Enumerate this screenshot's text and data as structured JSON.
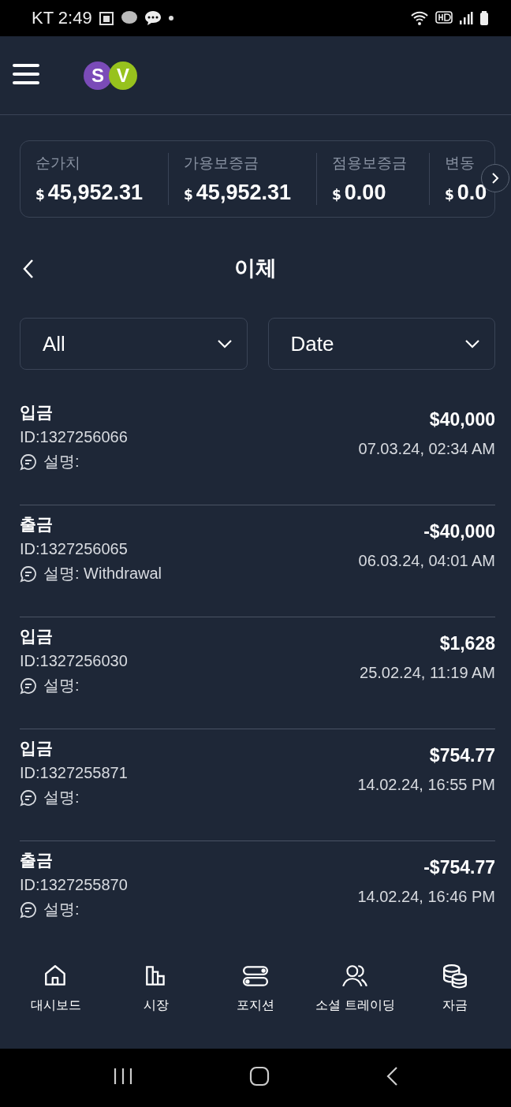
{
  "status_bar": {
    "carrier_time": "KT 2:49"
  },
  "header": {
    "logo_letters": [
      "S",
      "V"
    ]
  },
  "summary": [
    {
      "label": "순가치",
      "currency": "$",
      "value": "45,952.31"
    },
    {
      "label": "가용보증금",
      "currency": "$",
      "value": "45,952.31"
    },
    {
      "label": "점용보증금",
      "currency": "$",
      "value": "0.00"
    },
    {
      "label": "변동",
      "currency": "$",
      "value": "0.0"
    }
  ],
  "page_title": "이체",
  "filters": [
    {
      "value": "All"
    },
    {
      "value": "Date"
    }
  ],
  "transactions": [
    {
      "type": "입금",
      "id": "ID:1327256066",
      "note": "설명:",
      "amount": "$40,000",
      "date": "07.03.24, 02:34 AM"
    },
    {
      "type": "출금",
      "id": "ID:1327256065",
      "note": "설명: Withdrawal",
      "amount": "-$40,000",
      "date": "06.03.24, 04:01 AM"
    },
    {
      "type": "입금",
      "id": "ID:1327256030",
      "note": "설명:",
      "amount": "$1,628",
      "date": "25.02.24, 11:19 AM"
    },
    {
      "type": "입금",
      "id": "ID:1327255871",
      "note": "설명:",
      "amount": "$754.77",
      "date": "14.02.24, 16:55 PM"
    },
    {
      "type": "출금",
      "id": "ID:1327255870",
      "note": "설명:",
      "amount": "-$754.77",
      "date": "14.02.24, 16:46 PM"
    }
  ],
  "bottom_nav": [
    {
      "label": "대시보드",
      "kind": "home"
    },
    {
      "label": "시장",
      "kind": "market"
    },
    {
      "label": "포지션",
      "kind": "positions"
    },
    {
      "label": "소셜 트레이딩",
      "kind": "social"
    },
    {
      "label": "자금",
      "kind": "funds"
    }
  ]
}
